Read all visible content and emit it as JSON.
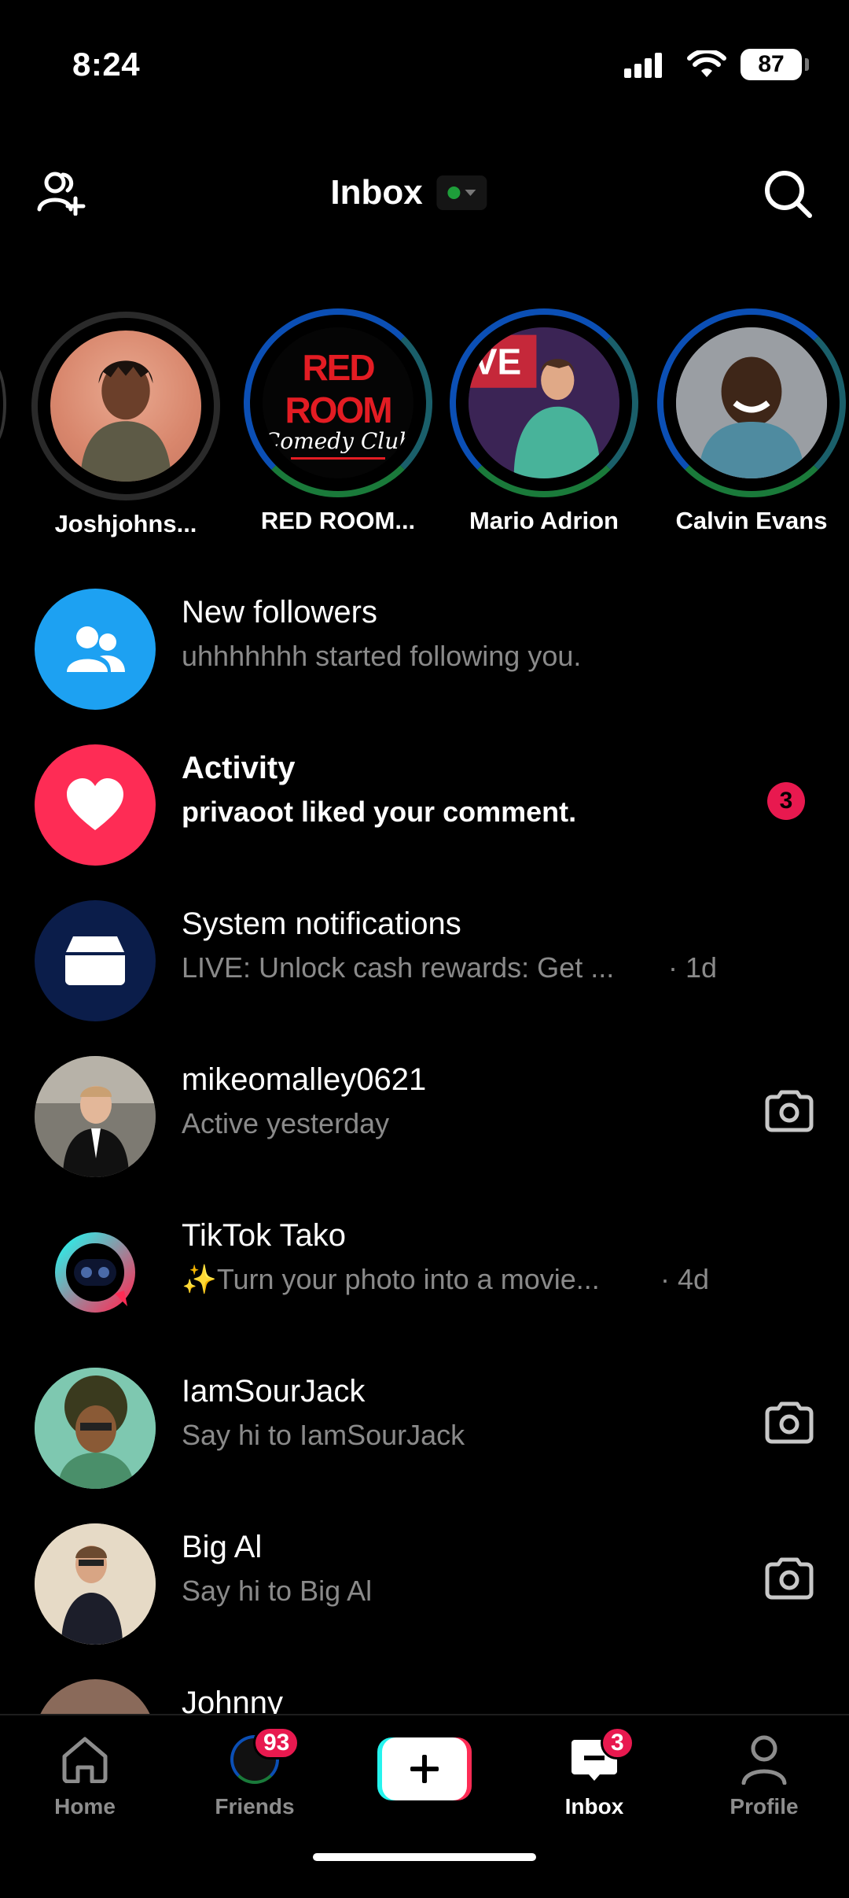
{
  "status_bar": {
    "time": "8:24",
    "battery": "87"
  },
  "header": {
    "title": "Inbox"
  },
  "stories": [
    {
      "name": "Joshjohns..."
    },
    {
      "name": "RED ROOM...",
      "logo_line1": "RED ROOM",
      "logo_line2": "Comedy Club"
    },
    {
      "name": "Mario Adrion"
    },
    {
      "name": "Calvin Evans"
    }
  ],
  "rows": [
    {
      "title": "New followers",
      "subtitle": "uhhhhhhh started following you.",
      "icon": "people-icon",
      "color": "#1da1f2"
    },
    {
      "title": "Activity",
      "subtitle": "privaoot liked your comment.",
      "badge": "3",
      "icon": "heart-icon",
      "color": "#fe2c55"
    },
    {
      "title": "System notifications",
      "subtitle": "LIVE: Unlock cash rewards: Get ...",
      "meta": "· 1d",
      "icon": "inbox-tray-icon",
      "color": "#0b1d4a"
    },
    {
      "title": "mikeomalley0621",
      "subtitle": "Active yesterday",
      "icon": "camera-icon"
    },
    {
      "title": "TikTok Tako",
      "subtitle": "✨Turn your photo into a movie...",
      "meta": "· 4d"
    },
    {
      "title": "IamSourJack",
      "subtitle": "Say hi to IamSourJack",
      "icon": "camera-icon"
    },
    {
      "title": "Big Al",
      "subtitle": "Say hi to Big Al",
      "icon": "camera-icon"
    },
    {
      "title": "Johnny"
    }
  ],
  "nav": {
    "home": "Home",
    "friends": "Friends",
    "friends_badge": "93",
    "inbox": "Inbox",
    "inbox_badge": "3",
    "profile": "Profile",
    "create_icon": "plus-icon"
  },
  "colors": {
    "accent_red": "#fe2c55",
    "accent_cyan": "#25f4ee",
    "blue": "#1da1f2"
  }
}
